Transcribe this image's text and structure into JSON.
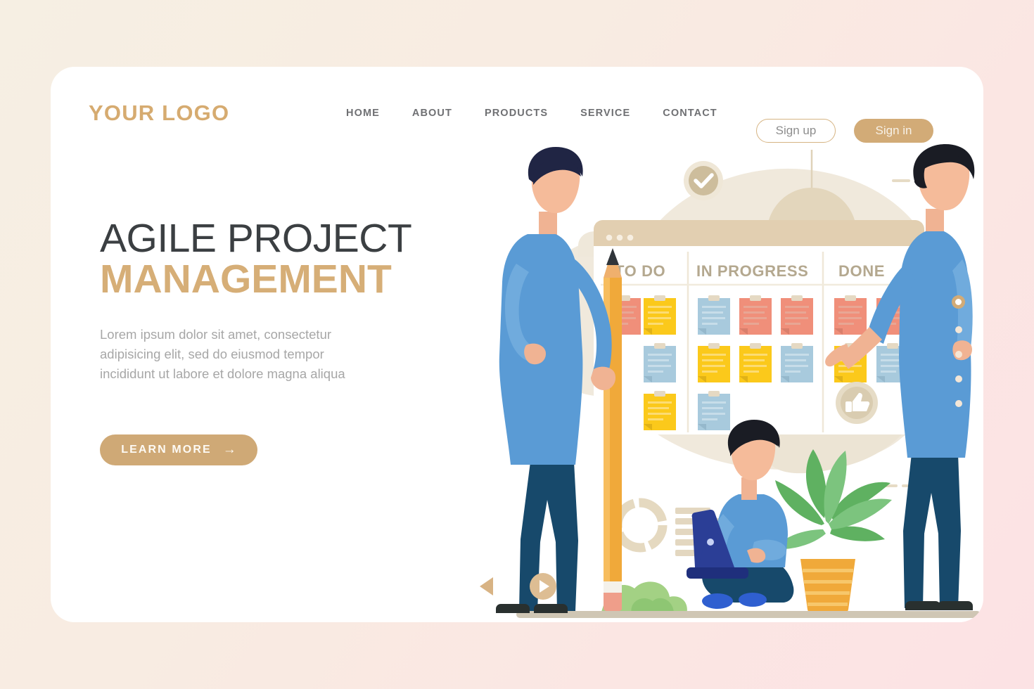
{
  "page": {
    "bg_start": "#f6efe3",
    "bg_end": "#fce2e4",
    "card_bg": "#ffffff",
    "accent": "#d2ab77",
    "heading_dark": "#3b3f42"
  },
  "header": {
    "logo": "YOUR LOGO",
    "nav": [
      {
        "label": "HOME"
      },
      {
        "label": "ABOUT"
      },
      {
        "label": "PRODUCTS"
      },
      {
        "label": "SERVICE"
      },
      {
        "label": "CONTACT"
      }
    ],
    "signup_label": "Sign up",
    "signin_label": "Sign in"
  },
  "hero": {
    "title_line1": "AGILE PROJECT",
    "title_line2": "MANAGEMENT",
    "paragraph": "Lorem ipsum dolor sit amet, consectetur adipisicing elit, sed do eiusmod tempor incididunt ut labore et dolore magna aliqua",
    "cta_label": "LEARN MORE",
    "cta_arrow": "→"
  },
  "illustration": {
    "board": {
      "columns": [
        {
          "title": "TO DO",
          "notes": [
            "salmon",
            "yellow",
            "blue",
            "yellow"
          ]
        },
        {
          "title": "IN PROGRESS",
          "notes": [
            "blue",
            "salmon",
            "salmon",
            "yellow",
            "yellow",
            "blue",
            "blue"
          ]
        },
        {
          "title": "DONE",
          "notes": [
            "salmon",
            "salmon",
            "yellow",
            "blue"
          ]
        }
      ],
      "note_colors": {
        "salmon": "#f08f7a",
        "yellow": "#fbc91b",
        "blue": "#a8cadd"
      }
    },
    "badges": [
      {
        "name": "check-badge",
        "glyph": "✓"
      },
      {
        "name": "thumbs-up-badge",
        "glyph": "👍"
      }
    ],
    "decor": [
      {
        "name": "plus-mark"
      },
      {
        "name": "pendant-lamp"
      },
      {
        "name": "donut-chart"
      },
      {
        "name": "ring-outline"
      },
      {
        "name": "dash-marks"
      }
    ],
    "people": [
      {
        "name": "standing-person-with-pencil"
      },
      {
        "name": "seated-person-with-laptop"
      },
      {
        "name": "person-pointing-at-board"
      }
    ],
    "props": [
      {
        "name": "giant-pencil"
      },
      {
        "name": "potted-plant"
      },
      {
        "name": "bushes"
      },
      {
        "name": "ground-line"
      }
    ]
  },
  "carousel": {
    "prev_label": "Previous",
    "play_label": "Play",
    "dots": [
      {
        "active": true
      },
      {
        "active": false
      },
      {
        "active": false
      },
      {
        "active": false
      },
      {
        "active": false
      }
    ]
  }
}
